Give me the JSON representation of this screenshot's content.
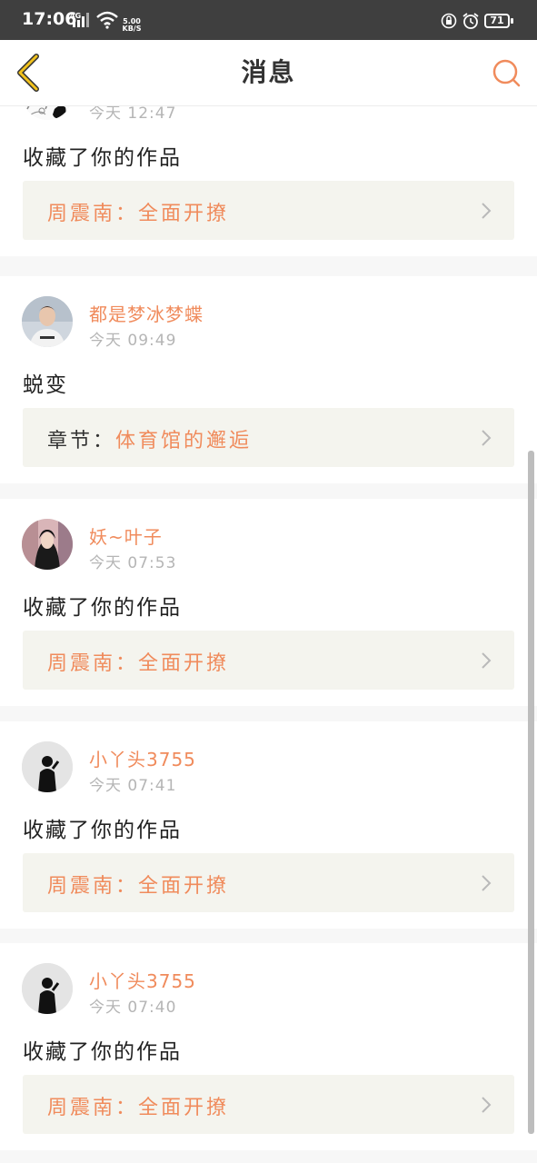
{
  "status_bar": {
    "time": "17:06",
    "network": "4G",
    "speed_top": "5.00",
    "speed_bottom": "KB/S",
    "battery": "71"
  },
  "navbar": {
    "title": "消息"
  },
  "colors": {
    "accent": "#f08b5c",
    "link_bg": "#f4f4ee",
    "back_icon": "#e6ad1a"
  },
  "messages": [
    {
      "username": "",
      "time": "今天 12:47",
      "action": "收藏了你的作品",
      "link_prefix": "周震南：",
      "link_title": "全面开撩",
      "avatar": "sketch-avatar"
    },
    {
      "username": "都是梦冰梦蝶",
      "time": "今天 09:49",
      "action": "蜕变",
      "link_prefix": "章节：",
      "link_title": "体育馆的邂逅",
      "avatar": "boy-avatar"
    },
    {
      "username": "妖~叶子",
      "time": "今天 07:53",
      "action": "收藏了你的作品",
      "link_prefix": "周震南：",
      "link_title": "全面开撩",
      "avatar": "girl-avatar"
    },
    {
      "username": "小丫头3755",
      "time": "今天 07:41",
      "action": "收藏了你的作品",
      "link_prefix": "周震南：",
      "link_title": "全面开撩",
      "avatar": "silhouette-avatar"
    },
    {
      "username": "小丫头3755",
      "time": "今天 07:40",
      "action": "收藏了你的作品",
      "link_prefix": "周震南：",
      "link_title": "全面开撩",
      "avatar": "silhouette-avatar"
    }
  ]
}
